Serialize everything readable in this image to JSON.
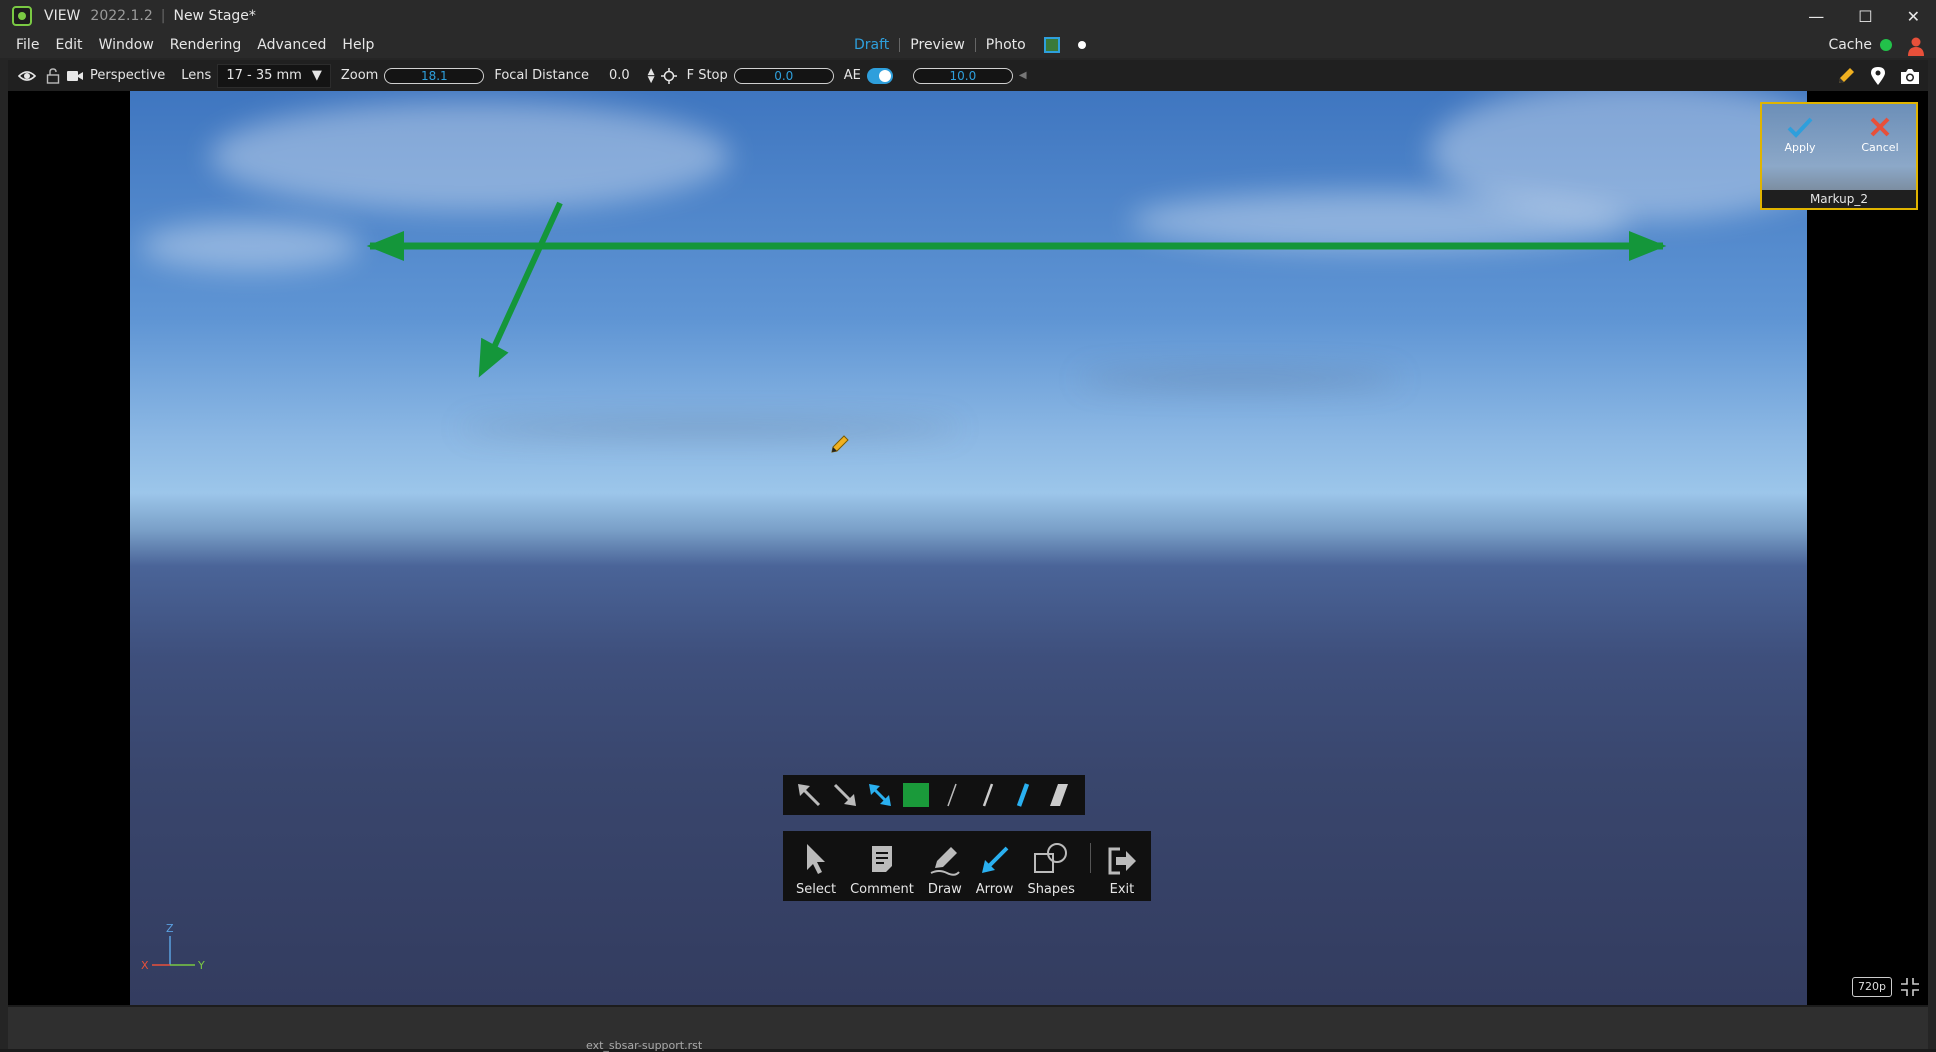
{
  "title_bar": {
    "app_name": "VIEW",
    "version": "2022.1.2",
    "stage_name": "New Stage*",
    "controls": [
      "—",
      "☐",
      "✕"
    ]
  },
  "menu": {
    "items": [
      "File",
      "Edit",
      "Window",
      "Rendering",
      "Advanced",
      "Help"
    ],
    "modes": [
      "Draft",
      "Preview",
      "Photo"
    ],
    "active_mode": "Draft",
    "cache_label": "Cache"
  },
  "toolbar": {
    "camera_label": "Perspective",
    "lens_label": "Lens",
    "lens_value": "17 - 35 mm",
    "zoom_label": "Zoom",
    "zoom_value": "18.1",
    "focal_label": "Focal Distance",
    "focal_value": "0.0",
    "fstop_label": "F Stop",
    "fstop_value": "0.0",
    "ae_label": "AE",
    "ae_value": "10.0"
  },
  "markup_panel": {
    "apply_label": "Apply",
    "cancel_label": "Cancel",
    "name": "Markup_2"
  },
  "markup_tools": {
    "items": [
      {
        "label": "Select",
        "icon": "cursor-icon"
      },
      {
        "label": "Comment",
        "icon": "comment-icon"
      },
      {
        "label": "Draw",
        "icon": "pen-icon"
      },
      {
        "label": "Arrow",
        "icon": "arrow-icon"
      },
      {
        "label": "Shapes",
        "icon": "shapes-icon"
      },
      {
        "label": "Exit",
        "icon": "exit-icon"
      }
    ],
    "active_tool": "Arrow",
    "active_color": "#1a9a3a"
  },
  "viewport": {
    "axis_labels": {
      "x": "X",
      "y": "Y",
      "z": "Z"
    },
    "resolution_badge": "720p"
  },
  "status": {
    "file_hint": "ext_sbsar-support.rst"
  }
}
